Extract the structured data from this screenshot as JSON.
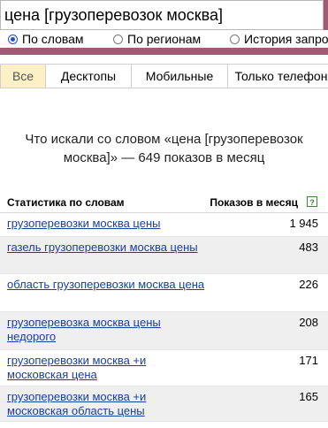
{
  "search": {
    "query": "цена [грузоперевозок москва]"
  },
  "modes": [
    {
      "label": "По словам",
      "selected": true
    },
    {
      "label": "По регионам",
      "selected": false
    },
    {
      "label": "История запросов",
      "selected": false
    }
  ],
  "tabs": [
    {
      "label": "Все",
      "active": true
    },
    {
      "label": "Десктопы",
      "active": false
    },
    {
      "label": "Мобильные",
      "active": false
    },
    {
      "label": "Только телефоны",
      "active": false
    }
  ],
  "result": {
    "title": "Что искали со словом «цена [грузоперевозок москва]» — 649 показов в месяц",
    "col_words": "Статистика по словам",
    "col_shows": "Показов в месяц",
    "help_icon": "?",
    "rows": [
      {
        "phrase": "грузоперевозки москва цены",
        "count": "1 945"
      },
      {
        "phrase": "газель грузоперевозки москва цены",
        "count": "483"
      },
      {
        "phrase": "область грузоперевозки москва цена",
        "count": "226"
      },
      {
        "phrase": "грузоперевозка москва цены недорого",
        "count": "208"
      },
      {
        "phrase": "грузоперевозки москва +и московская цена",
        "count": "171"
      },
      {
        "phrase": "грузоперевозки москва +и московская область цены",
        "count": "165"
      }
    ]
  },
  "colors": {
    "header": "#9c5c73",
    "link": "#1a3e9e",
    "active_tab": "#fdf0c5",
    "alt_row": "#efefef"
  }
}
